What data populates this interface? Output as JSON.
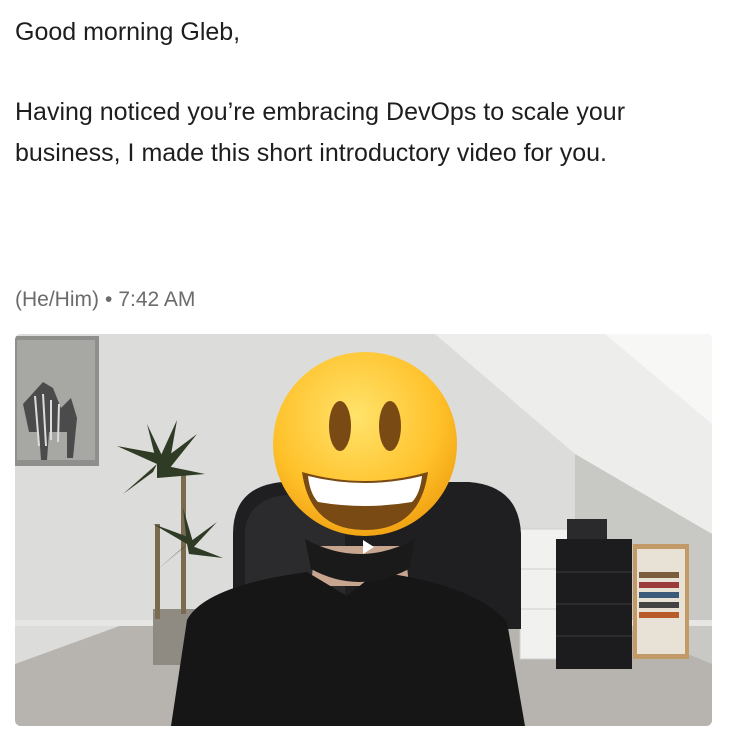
{
  "message": {
    "greeting": "Good morning Gleb,",
    "body": "Having noticed you’re embracing DevOps to scale your business, I made this short introductory video for you."
  },
  "meta": {
    "pronouns": "(He/Him)",
    "separator": "•",
    "time": "7:42 AM"
  },
  "video": {
    "play_icon": "play-icon",
    "face_overlay": "grinning-emoji"
  }
}
